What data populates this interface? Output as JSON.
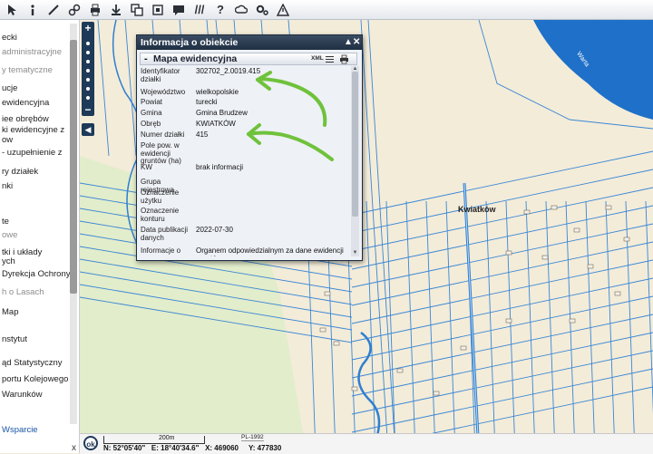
{
  "toolbar": {
    "buttons": [
      "select-icon",
      "info-icon",
      "ruler-icon",
      "link-icon",
      "print-icon",
      "download-icon",
      "layers-icon",
      "copy-icon",
      "comment-icon",
      "hatch-icon",
      "help-icon",
      "cloud-icon",
      "settings-icon",
      "warning-icon"
    ],
    "hatch_glyph": "///",
    "help_glyph": "?"
  },
  "sidebar": {
    "items": [
      {
        "label": "ecki",
        "muted": false
      },
      {
        "label": "administracyjne",
        "muted": true
      },
      {
        "label": "y tematyczne",
        "muted": true
      },
      {
        "label": "ucje",
        "muted": false
      },
      {
        "label": "ewidencyjna",
        "muted": false
      },
      {
        "label": "iee obrębów",
        "muted": false
      },
      {
        "label": "ki ewidencyjne z",
        "muted": false
      },
      {
        "label": "ow",
        "muted": false
      },
      {
        "label": "- uzupełnienie z",
        "muted": false
      },
      {
        "label": "ry działek",
        "muted": false
      },
      {
        "label": "nki",
        "muted": false
      },
      {
        "label": "te",
        "muted": false
      },
      {
        "label": "owe",
        "muted": true
      },
      {
        "label": "tki i układy",
        "muted": false
      },
      {
        "label": "ych",
        "muted": false
      },
      {
        "label": "Dyrekcja Ochrony",
        "muted": false
      },
      {
        "label": "h o Lasach",
        "muted": true
      },
      {
        "label": "Map",
        "muted": false
      },
      {
        "label": "nstytut",
        "muted": false
      },
      {
        "label": "ąd Statystyczny",
        "muted": false
      },
      {
        "label": "portu Kolejowego",
        "muted": false
      },
      {
        "label": "Warunków",
        "muted": false
      }
    ],
    "wsparcie": "Wsparcie",
    "close": "x"
  },
  "zoom": {
    "plus": "+",
    "minus": "−",
    "collapse": "◀"
  },
  "dialog": {
    "title": "Informacja o obiekcie",
    "controls": [
      "▲",
      "✕"
    ],
    "section_title": "Mapa ewidencyjna",
    "collapse": "-",
    "xml": "XML",
    "rows": [
      {
        "label": "Identyfikator działki",
        "value": "302702_2.0019.415"
      },
      {
        "label": "Województwo",
        "value": "wielkopolskie"
      },
      {
        "label": "Powiat",
        "value": "turecki"
      },
      {
        "label": "Gmina",
        "value": "Gmina Brudzew"
      },
      {
        "label": "Obręb",
        "value": "KWIATKÓW"
      },
      {
        "label": "Numer działki",
        "value": "415"
      },
      {
        "label": "Pole pow. w ewidencji gruntów (ha)",
        "value": ""
      },
      {
        "label": "KW",
        "value": "brak informacji"
      },
      {
        "label": "Grupa rejestrowa",
        "value": ""
      },
      {
        "label": "Oznaczenie użytku",
        "value": ""
      },
      {
        "label": "Oznaczenie konturu",
        "value": ""
      },
      {
        "label": "Data publikacji danych",
        "value": "2022-07-30"
      },
      {
        "label": "Informacje o",
        "value": "Organem odpowiedzialnym za dane ewidencji gruntów"
      }
    ]
  },
  "map": {
    "place_label": "Kwiatków",
    "water_label": "Warta"
  },
  "status": {
    "ok": "ok",
    "scale_label": "200m",
    "crs": "PL-1992",
    "coords": "N: 52°05'40\"   E: 18°40'34.6\"   X: 469060     Y: 477830"
  },
  "colors": {
    "map_bg": "#f3ecd9",
    "parcel_line": "#2f7fd0",
    "water": "#1c6fc4",
    "forest": "#dfeccb",
    "arrow": "#6fc23b",
    "toolbar_dark": "#1e3a58"
  }
}
